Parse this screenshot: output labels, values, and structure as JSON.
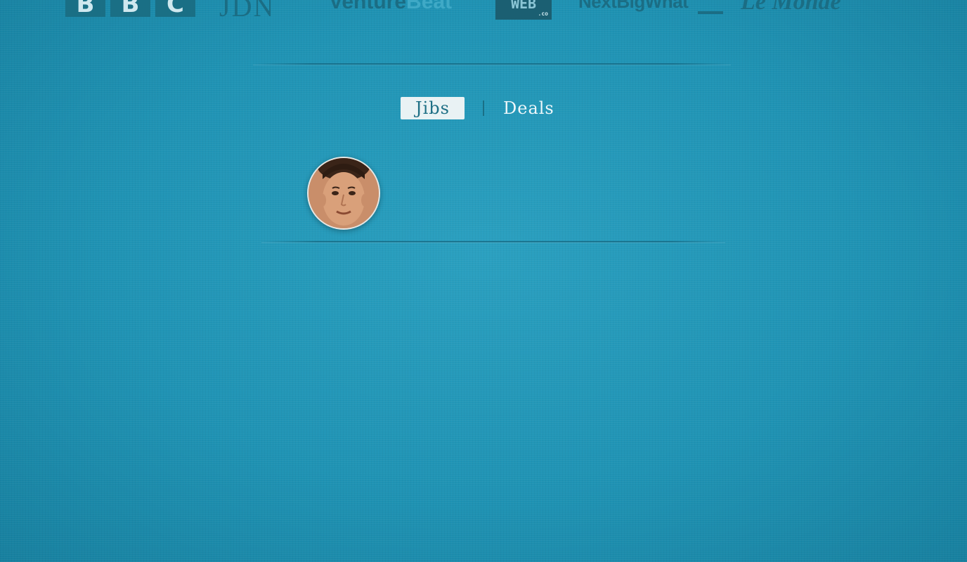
{
  "press_logos": {
    "bbc": [
      "B",
      "B",
      "C"
    ],
    "jdn": "JDN",
    "venturebeat": {
      "part1": "Venture",
      "part2": "Beat"
    },
    "web_co": {
      "main": "WEB",
      "suffix": ".co"
    },
    "nextbigwhat": "NextBigWhat",
    "lemonde": "Le Monde"
  },
  "tabs": [
    {
      "label": "Jibs",
      "active": true
    },
    {
      "label": "Deals",
      "active": false
    }
  ],
  "colors": {
    "background": "#1f93b4",
    "active_tab_bg": "#e9f2f4",
    "active_tab_text": "#1e6f85",
    "inactive_tab_text": "#eef7fa",
    "logo_color": "#1b6d84"
  }
}
